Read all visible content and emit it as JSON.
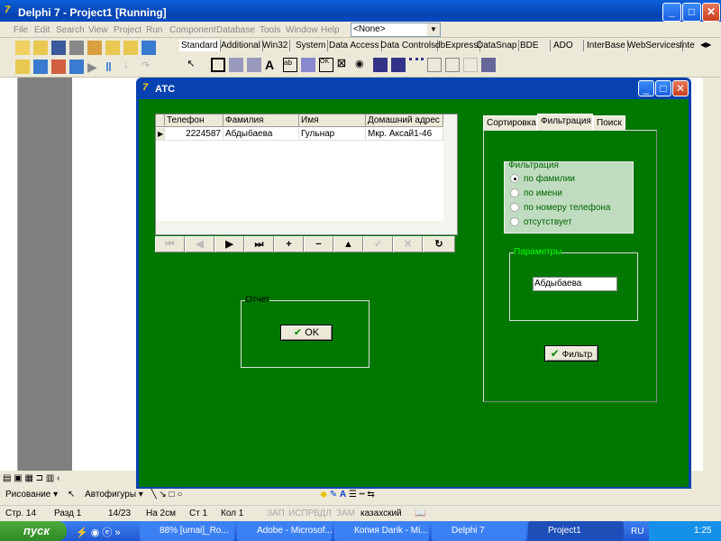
{
  "ide": {
    "title": "Delphi 7 - Project1 [Running]",
    "menu": [
      "File",
      "Edit",
      "Search",
      "View",
      "Project",
      "Run",
      "Component",
      "Database",
      "Tools",
      "Window",
      "Help"
    ],
    "component_combo": "<None>",
    "palette_tabs": [
      "Standard",
      "Additional",
      "Win32",
      "System",
      "Data Access",
      "Data Controls",
      "dbExpress",
      "DataSnap",
      "BDE",
      "ADO",
      "InterBase",
      "WebServices",
      "Inte"
    ]
  },
  "form": {
    "title": "АТС",
    "grid": {
      "columns": [
        "Телефон",
        "Фамилия",
        "Имя",
        "Домашний адрес"
      ],
      "rows": [
        [
          "2224587",
          "Абдыбаева",
          "Гульнар",
          "Мкр. Аксай1-46"
        ]
      ]
    },
    "navigator": [
      "⏮",
      "◀",
      "▶",
      "⏭",
      "+",
      "−",
      "▲",
      "✓",
      "✕",
      "↻"
    ],
    "report_group": "Отчет",
    "ok_label": "OK",
    "tabs": [
      "Сортировка",
      "Фильтрация",
      "Поиск"
    ],
    "filter_group": "Фильтрация",
    "filter_options": [
      {
        "label": "по фамилии",
        "checked": true
      },
      {
        "label": "по имени",
        "checked": false
      },
      {
        "label": "по номеру телефона",
        "checked": false
      },
      {
        "label": "отсутствует",
        "checked": false
      }
    ],
    "params_group": "Параметры",
    "param_value": "Абдыбаева",
    "filter_button": "Фильтр"
  },
  "word": {
    "drawing": "Рисование ▾",
    "autoshapes": "Автофигуры ▾",
    "status": {
      "page": "Стр. 14",
      "section": "Разд 1",
      "pages": "14/23",
      "at": "На 2см",
      "line": "Ст 1",
      "col": "Кол 1",
      "rec": "ЗАП",
      "trk": "ИСПР",
      "ext": "ВДЛ",
      "ovr": "ЗАМ",
      "lang": "казахский"
    }
  },
  "taskbar": {
    "start": "пуск",
    "items": [
      "88% [umai]_Ro...",
      "Adobe - Microsof...",
      "Копия Darik - Mi...",
      "Delphi 7",
      "Project1"
    ],
    "lang": "RU",
    "time": "1:25"
  },
  "colors": {
    "form_bg": "#007800",
    "title_blue": "#0a5fd8"
  }
}
